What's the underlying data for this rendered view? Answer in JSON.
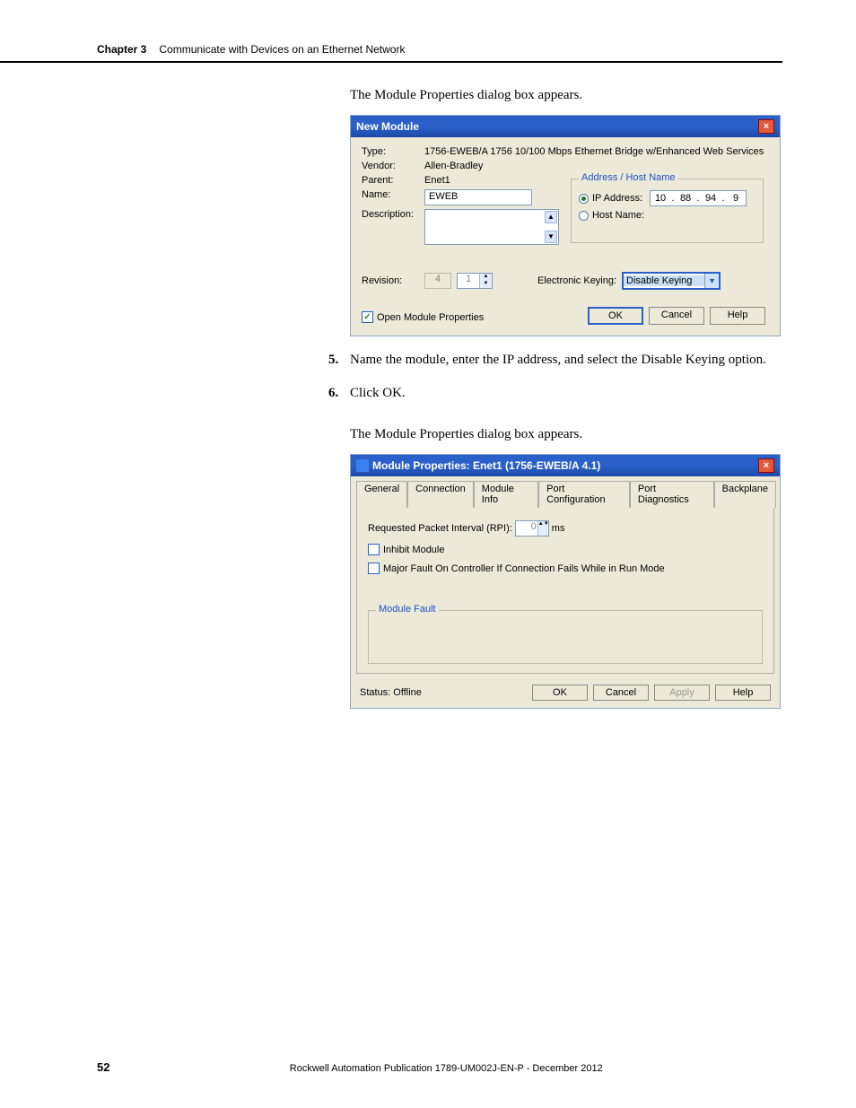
{
  "header": {
    "chapter": "Chapter 3",
    "title": "Communicate with Devices on an Ethernet Network"
  },
  "intro1": "The Module Properties dialog box appears.",
  "dialog1": {
    "title": "New Module",
    "labels": {
      "type": "Type:",
      "vendor": "Vendor:",
      "parent": "Parent:",
      "name": "Name:",
      "description": "Description:",
      "revision": "Revision:"
    },
    "values": {
      "type": "1756-EWEB/A 1756 10/100 Mbps Ethernet Bridge w/Enhanced Web Services",
      "vendor": "Allen-Bradley",
      "parent": "Enet1",
      "name": "EWEB"
    },
    "group_legend": "Address / Host Name",
    "ip_label": "IP Address:",
    "host_label": "Host Name:",
    "ip": {
      "a": "10",
      "b": "88",
      "c": "94",
      "d": "9"
    },
    "rev_major": "4",
    "rev_minor": "1",
    "ek_label": "Electronic Keying:",
    "ek_value": "Disable Keying",
    "open_props": "Open Module Properties",
    "buttons": {
      "ok": "OK",
      "cancel": "Cancel",
      "help": "Help"
    }
  },
  "step5": {
    "num": "5.",
    "text": "Name the module, enter the IP address, and select the Disable Keying option."
  },
  "step6": {
    "num": "6.",
    "text": "Click OK."
  },
  "intro2": "The Module Properties dialog box appears.",
  "dialog2": {
    "title": "Module Properties: Enet1 (1756-EWEB/A 4.1)",
    "tabs": {
      "general": "General",
      "connection": "Connection",
      "module_info": "Module Info",
      "port_config": "Port Configuration",
      "port_diag": "Port Diagnostics",
      "backplane": "Backplane"
    },
    "rpi_label": "Requested Packet Interval (RPI):",
    "rpi_value": "0",
    "rpi_unit": "ms",
    "inhibit": "Inhibit Module",
    "major_fault": "Major Fault On Controller If Connection Fails While in Run Mode",
    "fault_legend": "Module Fault",
    "status_label": "Status:  Offline",
    "buttons": {
      "ok": "OK",
      "cancel": "Cancel",
      "apply": "Apply",
      "help": "Help"
    }
  },
  "footer": {
    "page": "52",
    "pub": "Rockwell Automation Publication 1789-UM002J-EN-P - December 2012"
  }
}
